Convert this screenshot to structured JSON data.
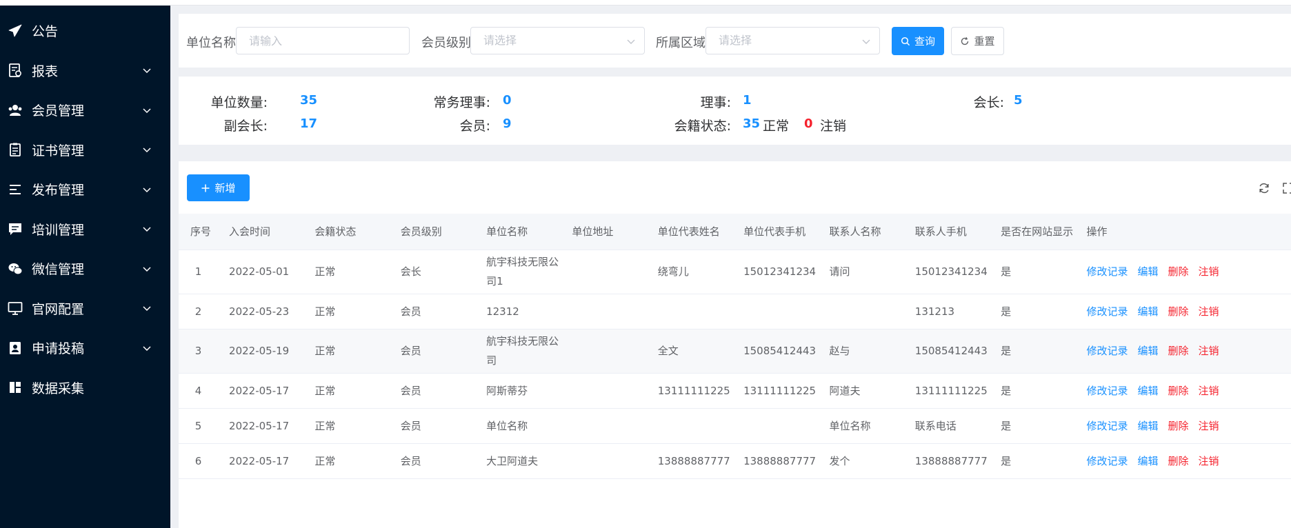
{
  "sidebar": {
    "items": [
      {
        "label": "公告",
        "icon": "send-icon",
        "expandable": false
      },
      {
        "label": "报表",
        "icon": "report-icon",
        "expandable": true
      },
      {
        "label": "会员管理",
        "icon": "team-icon",
        "expandable": true
      },
      {
        "label": "证书管理",
        "icon": "certificate-icon",
        "expandable": true
      },
      {
        "label": "发布管理",
        "icon": "list-icon",
        "expandable": true
      },
      {
        "label": "培训管理",
        "icon": "message-icon",
        "expandable": true
      },
      {
        "label": "微信管理",
        "icon": "wechat-icon",
        "expandable": true
      },
      {
        "label": "官网配置",
        "icon": "desktop-icon",
        "expandable": true
      },
      {
        "label": "申请投稿",
        "icon": "contacts-icon",
        "expandable": true
      },
      {
        "label": "数据采集",
        "icon": "layout-icon",
        "expandable": false
      }
    ]
  },
  "filter": {
    "unit_name_label": "单位名称",
    "unit_name_placeholder": "请输入",
    "level_label": "会员级别",
    "level_placeholder": "请选择",
    "region_label": "所属区域",
    "region_placeholder": "请选择",
    "query_label": "查询",
    "reset_label": "重置"
  },
  "stats": {
    "unit_count_label": "单位数量:",
    "unit_count": "35",
    "standing_director_label": "常务理事:",
    "standing_director": "0",
    "director_label": "理事:",
    "director": "1",
    "president_label": "会长:",
    "president": "5",
    "vice_president_label": "副会长:",
    "vice_president": "17",
    "member_label": "会员:",
    "member": "9",
    "status_label": "会籍状态:",
    "normal_count": "35",
    "normal_text": "正常",
    "cancelled_count": "0",
    "cancelled_text": "注销"
  },
  "toolbar": {
    "add_label": "新增"
  },
  "table": {
    "columns": [
      "序号",
      "入会时间",
      "会籍状态",
      "会员级别",
      "单位名称",
      "单位地址",
      "单位代表姓名",
      "单位代表手机",
      "联系人名称",
      "联系人手机",
      "是否在网站显示",
      "操作"
    ],
    "rows": [
      {
        "idx": "1",
        "join_date": "2022-05-01",
        "status": "正常",
        "level": "会长",
        "unit_name": "航宇科技无限公司1",
        "address": "",
        "rep_name": "绕弯儿",
        "rep_phone": "15012341234",
        "contact_name": "请问",
        "contact_phone": "15012341234",
        "show_on_site": "是"
      },
      {
        "idx": "2",
        "join_date": "2022-05-23",
        "status": "正常",
        "level": "会员",
        "unit_name": "12312",
        "address": "",
        "rep_name": "",
        "rep_phone": "",
        "contact_name": "",
        "contact_phone": "131213",
        "show_on_site": "是"
      },
      {
        "idx": "3",
        "join_date": "2022-05-19",
        "status": "正常",
        "level": "会员",
        "unit_name": "航宇科技无限公司",
        "address": "",
        "rep_name": "全文",
        "rep_phone": "15085412443",
        "contact_name": "赵与",
        "contact_phone": "15085412443",
        "show_on_site": "是"
      },
      {
        "idx": "4",
        "join_date": "2022-05-17",
        "status": "正常",
        "level": "会员",
        "unit_name": "阿斯蒂芬",
        "address": "",
        "rep_name": "13111111225",
        "rep_phone": "13111111225",
        "contact_name": "阿道夫",
        "contact_phone": "13111111225",
        "show_on_site": "是"
      },
      {
        "idx": "5",
        "join_date": "2022-05-17",
        "status": "正常",
        "level": "会员",
        "unit_name": "单位名称",
        "address": "",
        "rep_name": "",
        "rep_phone": "",
        "contact_name": "单位名称",
        "contact_phone": "联系电话",
        "show_on_site": "是"
      },
      {
        "idx": "6",
        "join_date": "2022-05-17",
        "status": "正常",
        "level": "会员",
        "unit_name": "大卫阿道夫",
        "address": "",
        "rep_name": "13888887777",
        "rep_phone": "13888887777",
        "contact_name": "发个",
        "contact_phone": "13888887777",
        "show_on_site": "是"
      }
    ],
    "actions": {
      "history": "修改记录",
      "edit": "编辑",
      "delete": "删除",
      "cancel": "注销"
    }
  },
  "colors": {
    "sidebar_bg": "#001529",
    "primary": "#1890ff",
    "danger": "#f5222d"
  }
}
